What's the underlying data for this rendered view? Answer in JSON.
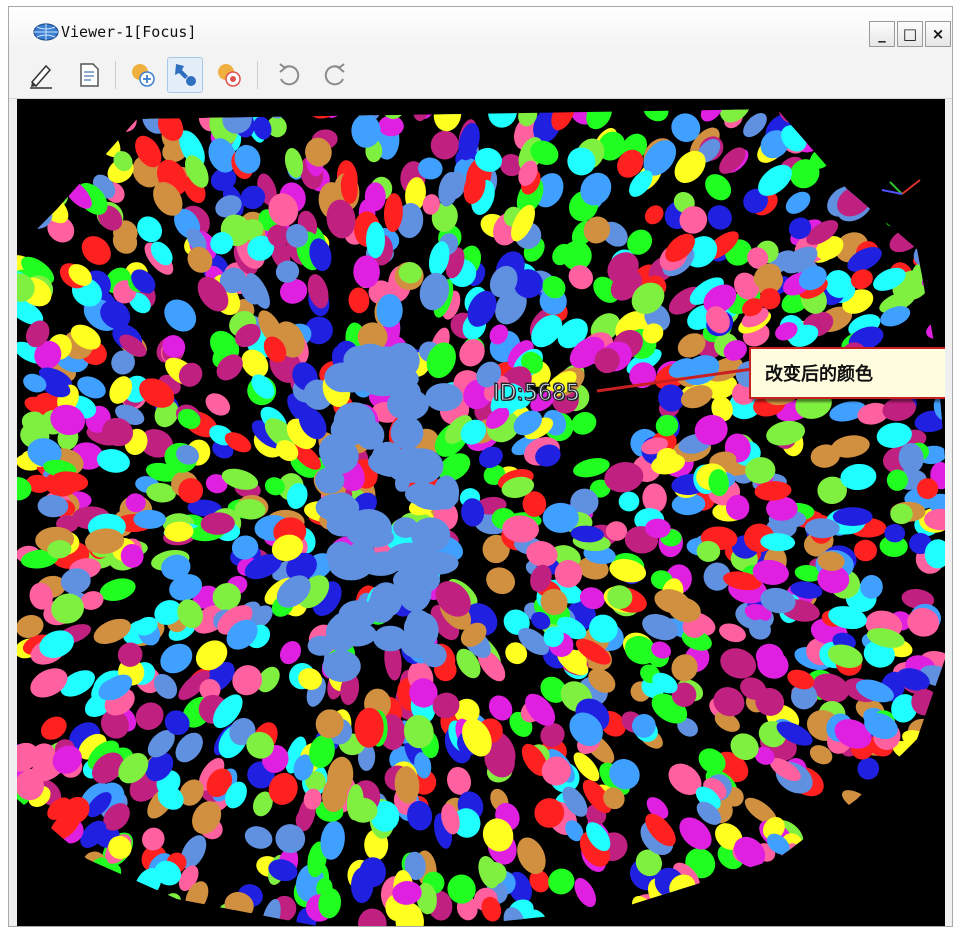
{
  "window": {
    "title": "Viewer-1[Focus]",
    "controls": {
      "minimize": "_",
      "maximize": "□",
      "close": "×"
    }
  },
  "toolbar": {
    "buttons": [
      {
        "name": "edit-icon",
        "active": false
      },
      {
        "name": "document-icon",
        "active": false
      },
      {
        "name": "add-point-icon",
        "active": false
      },
      {
        "name": "select-point-icon",
        "active": true
      },
      {
        "name": "remove-point-icon",
        "active": false
      },
      {
        "name": "undo-icon",
        "active": false
      },
      {
        "name": "redo-icon",
        "active": false
      }
    ]
  },
  "viewport": {
    "selected_label": "ID:5685",
    "annotation": "改变后的颜色",
    "annotation_color": "#c82020",
    "segment_palette": [
      "#ff2020",
      "#ffff20",
      "#20ff20",
      "#20ffff",
      "#2020e0",
      "#e020e0",
      "#c02080",
      "#d09040",
      "#6090e0",
      "#80f040",
      "#40a0ff",
      "#ff60a0"
    ]
  }
}
